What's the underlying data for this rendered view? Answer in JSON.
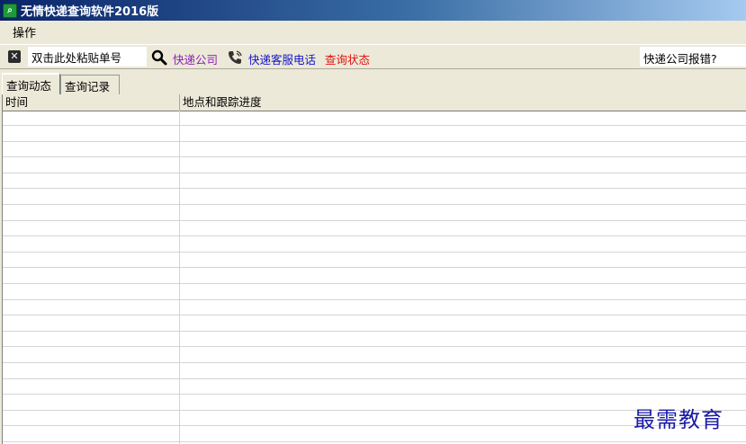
{
  "window": {
    "title": "无情快递查询软件2016版"
  },
  "menu": {
    "items": [
      "操作"
    ]
  },
  "toolbar": {
    "tracking_input_value": "双击此处粘贴单号",
    "company_link": "快递公司",
    "hotline_link": "快递客服电话",
    "status_link": "查询状态",
    "report_text": "快递公司报错?"
  },
  "tabs": [
    {
      "label": "查询动态",
      "active": true
    },
    {
      "label": "查询记录",
      "active": false
    }
  ],
  "table": {
    "columns": [
      "时间",
      "地点和跟踪进度"
    ],
    "rows": []
  },
  "watermark": "最需教育",
  "colors": {
    "company_link": "#8b1fb3",
    "hotline_link": "#1313c8",
    "status_link": "#e01010",
    "watermark": "#1a1aa6"
  }
}
